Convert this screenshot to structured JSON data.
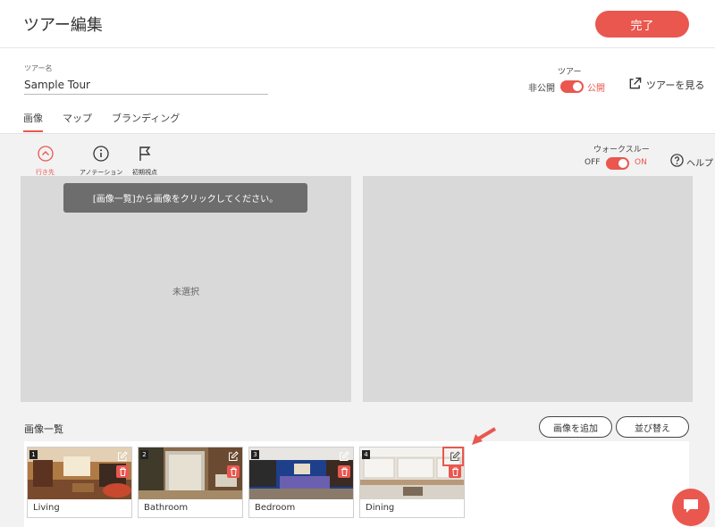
{
  "header": {
    "title": "ツアー編集",
    "done_label": "完了"
  },
  "tour_name": {
    "label": "ツアー名",
    "value": "Sample Tour"
  },
  "publish": {
    "label": "ツアー",
    "off_label": "非公開",
    "on_label": "公開",
    "is_public": true
  },
  "view_tour_label": "ツアーを見る",
  "tabs": [
    {
      "label": "画像",
      "active": true
    },
    {
      "label": "マップ",
      "active": false
    },
    {
      "label": "ブランディング",
      "active": false
    }
  ],
  "tools": {
    "destination": "行き先",
    "annotation": "アノテーション",
    "initial_view": "初期視点"
  },
  "walkthrough": {
    "label": "ウォークスルー",
    "off_label": "OFF",
    "on_label": "ON",
    "enabled": true
  },
  "help_label": "ヘルプ",
  "viewer": {
    "hint": "[画像一覧]から画像をクリックしてください。",
    "unselected": "未選択"
  },
  "image_list": {
    "title": "画像一覧",
    "add_label": "画像を追加",
    "sort_label": "並び替え",
    "items": [
      {
        "number": "1",
        "caption": "Living"
      },
      {
        "number": "2",
        "caption": "Bathroom"
      },
      {
        "number": "3",
        "caption": "Bedroom"
      },
      {
        "number": "4",
        "caption": "Dining"
      }
    ]
  },
  "colors": {
    "accent": "#e9574f",
    "panel": "#d9d9d9",
    "background": "#f2f2f2"
  }
}
